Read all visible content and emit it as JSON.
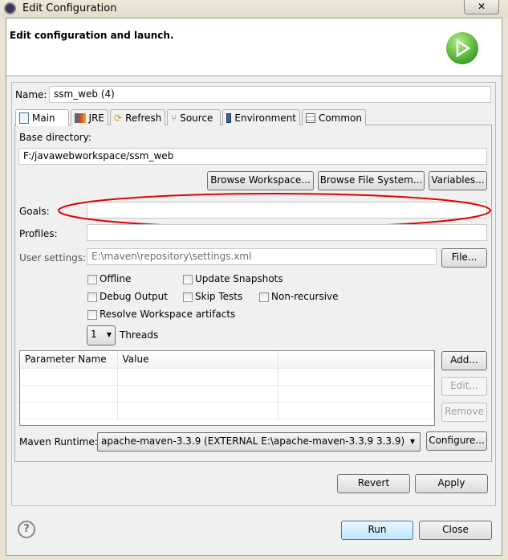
{
  "window": {
    "title": "Edit Configuration",
    "close_label": "✕"
  },
  "header": {
    "text": "Edit configuration and launch."
  },
  "name": {
    "label": "Name:",
    "value": "ssm_web (4)"
  },
  "tabs": [
    {
      "label": "Main",
      "icon": "document-icon"
    },
    {
      "label": "JRE",
      "icon": "books-icon"
    },
    {
      "label": "Refresh",
      "icon": "refresh-icon"
    },
    {
      "label": "Source",
      "icon": "source-icon"
    },
    {
      "label": "Environment",
      "icon": "environment-icon"
    },
    {
      "label": "Common",
      "icon": "table-icon"
    }
  ],
  "main": {
    "base_dir_label": "Base directory:",
    "base_dir_value": "F:/javawebworkspace/ssm_web",
    "browse_workspace": "Browse Workspace...",
    "browse_fs": "Browse File System...",
    "variables": "Variables...",
    "goals_label": "Goals:",
    "goals_value": "",
    "profiles_label": "Profiles:",
    "profiles_value": "",
    "user_settings_label": "User settings:",
    "user_settings_value": "E:\\maven\\repository\\settings.xml",
    "file_button": "File...",
    "checkboxes": {
      "offline": "Offline",
      "update_snapshots": "Update Snapshots",
      "debug_output": "Debug Output",
      "skip_tests": "Skip Tests",
      "non_recursive": "Non-recursive",
      "resolve_workspace": "Resolve Workspace artifacts"
    },
    "threads_value": "1",
    "threads_label": "Threads",
    "table_headers": [
      "Parameter Name",
      "Value"
    ],
    "add": "Add...",
    "edit": "Edit...",
    "remove": "Remove",
    "runtime_label": "Maven Runtime:",
    "runtime_value": "apache-maven-3.3.9 (EXTERNAL E:\\apache-maven-3.3.9 3.3.9)",
    "configure": "Configure..."
  },
  "revert": "Revert",
  "apply": "Apply",
  "run": "Run",
  "close": "Close",
  "help_symbol": "?",
  "annotation_color": "#e00000"
}
